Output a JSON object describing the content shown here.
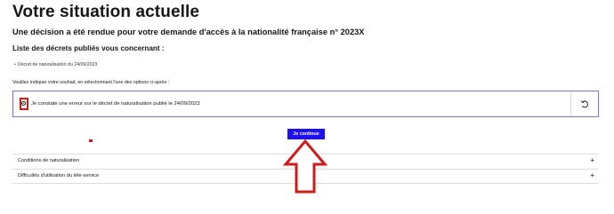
{
  "page": {
    "title": "Votre situation actuelle",
    "decision_text": "Une décision a été rendue pour votre demande d'accès à la nationalité française n° 2023X",
    "decrees_heading": "Liste des décrets publiés vous concernant :",
    "decrees": [
      "Décret de naturalisation du 24/09/2023"
    ],
    "instruction": "Veuillez indiquer votre souhait, en sélectionnant l'une des options ci-après :"
  },
  "options": [
    {
      "label": "Je constate une erreur sur le décret de naturalisation publié le 24/09/2023",
      "selected": false
    }
  ],
  "actions": {
    "continue_label": "Je continue",
    "reset_icon": "undo-icon"
  },
  "accordions": [
    {
      "label": "Conditions de naturalisation",
      "toggle": "+"
    },
    {
      "label": "Difficultés d'utilisation du télé-service",
      "toggle": "+"
    }
  ],
  "colors": {
    "primary": "#1f0ff5",
    "annotation": "#d11a1a",
    "option_border": "#7b74b8",
    "text": "#161616"
  }
}
